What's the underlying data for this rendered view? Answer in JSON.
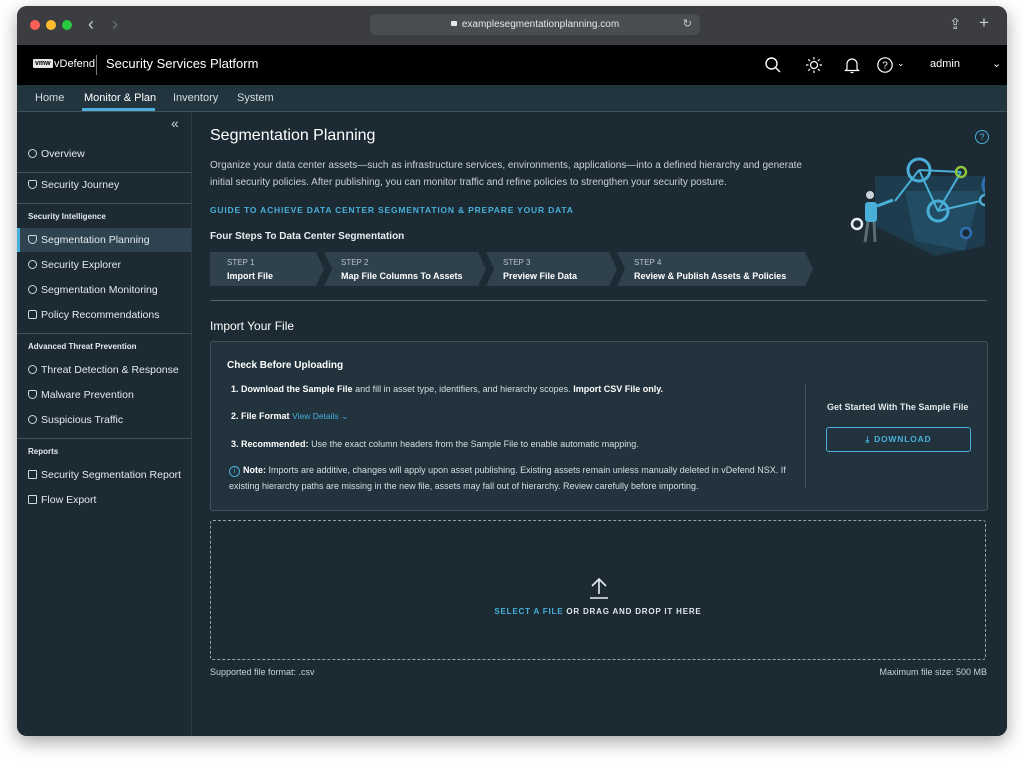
{
  "browser": {
    "url": "examplesegmentationplanning.com"
  },
  "header": {
    "logo": "vmw",
    "brand": "vDefend",
    "platform": "Security Services Platform",
    "user": "admin"
  },
  "topnav": {
    "items": [
      {
        "label": "Home"
      },
      {
        "label": "Monitor & Plan"
      },
      {
        "label": "Inventory"
      },
      {
        "label": "System"
      }
    ]
  },
  "sidebar": {
    "overview": "Overview",
    "security_journey": "Security Journey",
    "section_intelligence": "Security Intelligence",
    "segmentation_planning": "Segmentation Planning",
    "security_explorer": "Security Explorer",
    "segmentation_monitoring": "Segmentation Monitoring",
    "policy_recommendations": "Policy Recommendations",
    "section_threat": "Advanced Threat Prevention",
    "threat_detection": "Threat Detection & Response",
    "malware_prevention": "Malware Prevention",
    "suspicious_traffic": "Suspicious Traffic",
    "section_reports": "Reports",
    "security_segmentation_report": "Security Segmentation Report",
    "flow_export": "Flow Export"
  },
  "main": {
    "title": "Segmentation Planning",
    "description": "Organize your data center assets—such as infrastructure services, environments, applications—into a defined hierarchy and generate initial security policies. After publishing, you can monitor traffic and refine policies to strengthen your security posture.",
    "guide_link": "GUIDE TO ACHIEVE DATA CENTER SEGMENTATION & PREPARE YOUR DATA",
    "steps_title": "Four Steps To Data Center Segmentation",
    "steps": [
      {
        "number": "STEP 1",
        "label": "Import File"
      },
      {
        "number": "STEP 2",
        "label": "Map File Columns To Assets"
      },
      {
        "number": "STEP 3",
        "label": "Preview File Data"
      },
      {
        "number": "STEP 4",
        "label": "Review & Publish Assets & Policies"
      }
    ],
    "import_title": "Import Your File",
    "check_title": "Check Before Uploading",
    "item1_prefix": "1.",
    "item1_bold": "Download the Sample File",
    "item1_text": "and fill in asset type, identifiers, and hierarchy scopes.",
    "item1_bold2": "Import CSV File only.",
    "item2_prefix": "2.",
    "item2_bold": "File Format",
    "item2_link": "View Details",
    "item3_prefix": "3.",
    "item3_bold": "Recommended:",
    "item3_text": "Use the exact column headers from the Sample File to enable automatic mapping.",
    "note_bold": "Note:",
    "note_text": "Imports are additive, changes will apply upon asset publishing. Existing assets remain unless manually deleted in vDefend NSX. If existing hierarchy paths are missing in the new file, assets may fall out of hierarchy. Review carefully before importing.",
    "sample_title": "Get Started With The Sample File",
    "download_label": "DOWNLOAD",
    "select_file": "SELECT A FILE",
    "drag_drop": "OR DRAG AND DROP IT HERE",
    "supported_format": "Supported file format: .csv",
    "max_size": "Maximum file size: 500 MB"
  },
  "colors": {
    "accent": "#49afd9",
    "background": "#1b2a33",
    "header": "#000000"
  },
  "icons": [
    "back-icon",
    "forward-icon",
    "lock-icon",
    "reload-icon",
    "share-icon",
    "new-tab-icon",
    "search-icon",
    "theme-icon",
    "bell-icon",
    "help-icon",
    "chevron-down-icon",
    "collapse-icon",
    "upload-icon",
    "download-icon",
    "info-icon"
  ]
}
